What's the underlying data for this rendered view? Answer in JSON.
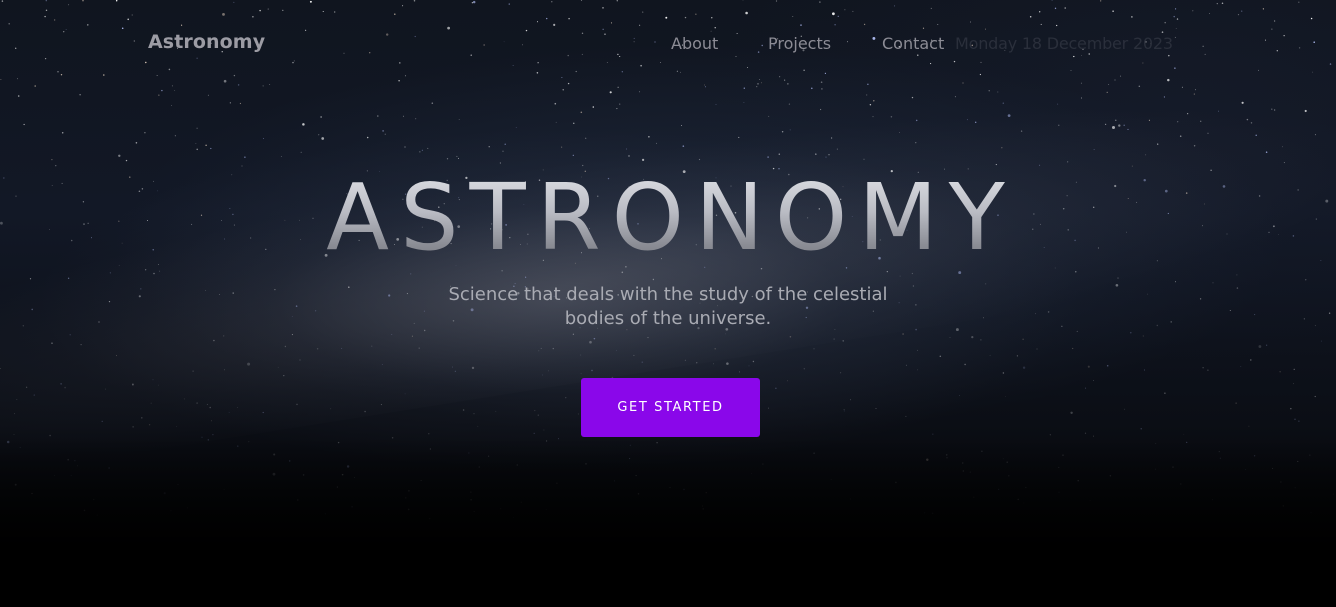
{
  "header": {
    "brand": "Astronomy",
    "nav": [
      "About",
      "Projects",
      "Contact"
    ],
    "date": "Monday 18 December 2023"
  },
  "hero": {
    "title": "ASTRONOMY",
    "subtitle": "Science that deals with the study of the celestial bodies of the universe.",
    "cta_label": "GET STARTED"
  },
  "colors": {
    "accent": "#8a07ea",
    "background": "#000000",
    "nav_text": "#8c8c95"
  }
}
